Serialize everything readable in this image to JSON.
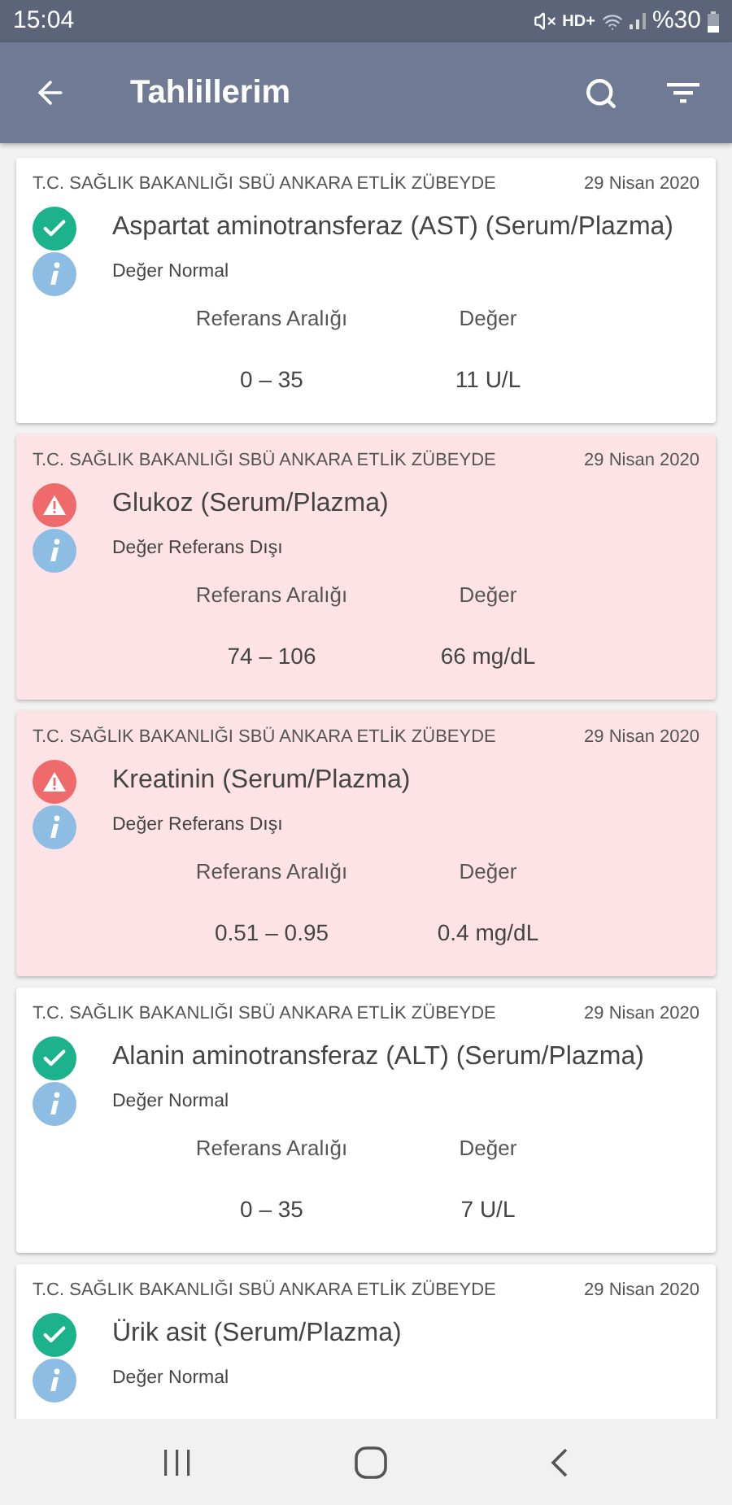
{
  "status_bar": {
    "time": "15:04",
    "network": "HD+",
    "battery": "%30"
  },
  "app_bar": {
    "title": "Tahlillerim"
  },
  "results": [
    {
      "hospital": "T.C. SAĞLIK BAKANLIĞI SBÜ ANKARA ETLİK ZÜBEYDE",
      "date": "29 Nisan 2020",
      "test": "Aspartat aminotransferaz (AST) (Serum/Plazma)",
      "kind": "normal",
      "note": "Değer Normal",
      "range_label": "Referans Aralığı",
      "value_label": "Değer",
      "range": "0 – 35",
      "value": "11 U/L"
    },
    {
      "hospital": "T.C. SAĞLIK BAKANLIĞI SBÜ ANKARA ETLİK ZÜBEYDE",
      "date": "29 Nisan 2020",
      "test": "Glukoz (Serum/Plazma)",
      "kind": "alert",
      "note": "Değer Referans Dışı",
      "range_label": "Referans Aralığı",
      "value_label": "Değer",
      "range": "74 – 106",
      "value": "66 mg/dL"
    },
    {
      "hospital": "T.C. SAĞLIK BAKANLIĞI SBÜ ANKARA ETLİK ZÜBEYDE",
      "date": "29 Nisan 2020",
      "test": "Kreatinin (Serum/Plazma)",
      "kind": "alert",
      "note": "Değer Referans Dışı",
      "range_label": "Referans Aralığı",
      "value_label": "Değer",
      "range": "0.51 – 0.95",
      "value": "0.4 mg/dL"
    },
    {
      "hospital": "T.C. SAĞLIK BAKANLIĞI SBÜ ANKARA ETLİK ZÜBEYDE",
      "date": "29 Nisan 2020",
      "test": "Alanin aminotransferaz (ALT) (Serum/Plazma)",
      "kind": "normal",
      "note": "Değer Normal",
      "range_label": "Referans Aralığı",
      "value_label": "Değer",
      "range": "0 – 35",
      "value": "7 U/L"
    },
    {
      "hospital": "T.C. SAĞLIK BAKANLIĞI SBÜ ANKARA ETLİK ZÜBEYDE",
      "date": "29 Nisan 2020",
      "test": "Ürik asit (Serum/Plazma)",
      "kind": "normal",
      "note": "Değer Normal"
    }
  ]
}
